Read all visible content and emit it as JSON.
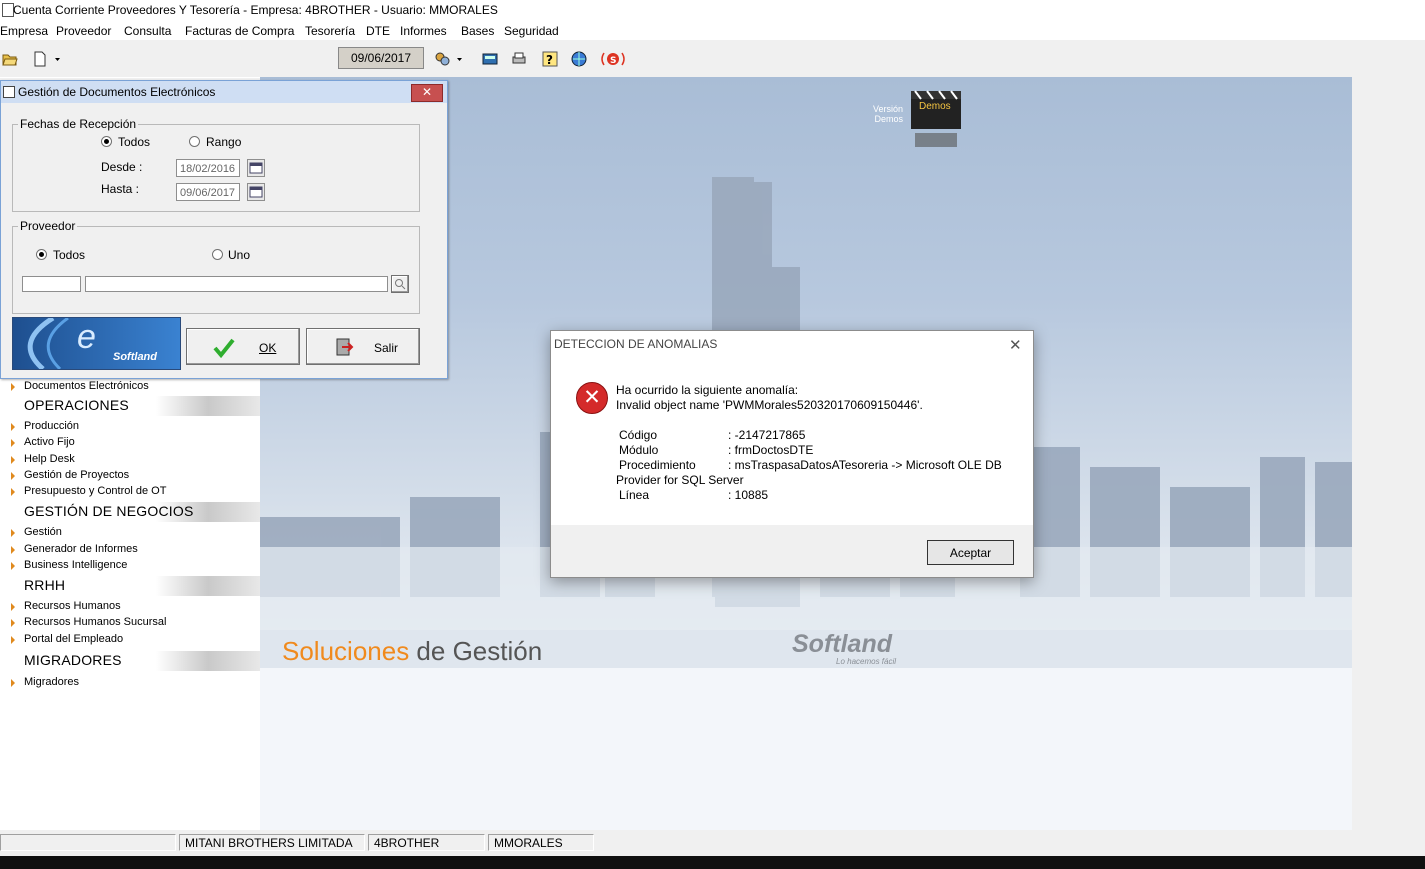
{
  "window": {
    "title": "Cuenta Corriente Proveedores Y Tesorería - Empresa: 4BROTHER - Usuario: MMORALES"
  },
  "menu": [
    "Empresa",
    "Proveedor",
    "Consulta",
    "Facturas de Compra",
    "Tesorería",
    "DTE",
    "Informes",
    "Bases",
    "Seguridad"
  ],
  "toolbar": {
    "date": "09/06/2017"
  },
  "background": {
    "version_label_1": "Versión",
    "version_label_2": "Demos",
    "clapper_label": "Demos",
    "tagline_part1": "Soluciones",
    "tagline_part2": " de Gestión",
    "brand": "Softland",
    "brand_slogan": "Lo hacemos fácil"
  },
  "doc_window": {
    "title": "Gestión de Documentos Electrónicos",
    "close": "✕",
    "fechas_group": "Fechas de Recepción",
    "radio_todos": "Todos",
    "radio_rango": "Rango",
    "desde_label": "Desde :",
    "hasta_label": "Hasta :",
    "desde_value": "18/02/2016",
    "hasta_value": "09/06/2017",
    "proveedor_group": "Proveedor",
    "radio_prov_todos": "Todos",
    "radio_prov_uno": "Uno",
    "logo_letter": "e",
    "logo_brand": "Softland",
    "ok_label": "OK",
    "salir_label": "Salir"
  },
  "sidebar": {
    "top_item": "Documentos Electrónicos",
    "sections": [
      {
        "title": "OPERACIONES",
        "items": [
          "Producción",
          "Activo Fijo",
          "Help Desk",
          "Gestión de Proyectos",
          "Presupuesto y Control de OT"
        ]
      },
      {
        "title": "GESTIÓN DE NEGOCIOS",
        "items": [
          "Gestión",
          "Generador de Informes",
          "Business Intelligence"
        ]
      },
      {
        "title": "RRHH",
        "items": [
          "Recursos Humanos",
          "Recursos Humanos Sucursal",
          "Portal del Empleado"
        ]
      },
      {
        "title": "MIGRADORES",
        "items": [
          "Migradores"
        ]
      }
    ]
  },
  "error_dialog": {
    "title": "DETECCION DE ANOMALIAS",
    "close": "✕",
    "icon": "✕",
    "line1": "Ha ocurrido la siguiente anomalía:",
    "line2": "Invalid object name 'PWMMorales520320170609150446'.",
    "codigo_label": "Código",
    "codigo_value": ": -2147217865",
    "modulo_label": "Módulo",
    "modulo_value": ": frmDoctosDTE",
    "proc_label": "Procedimiento",
    "proc_value": ": msTraspasaDatosATesoreria -> Microsoft OLE DB",
    "proc_cont": "Provider for SQL Server",
    "linea_label": "Línea",
    "linea_value": ": 10885",
    "accept_label": "Aceptar"
  },
  "statusbar": {
    "empresa": "MITANI BROTHERS LIMITADA",
    "codigo": "4BROTHER",
    "usuario": "MMORALES"
  }
}
